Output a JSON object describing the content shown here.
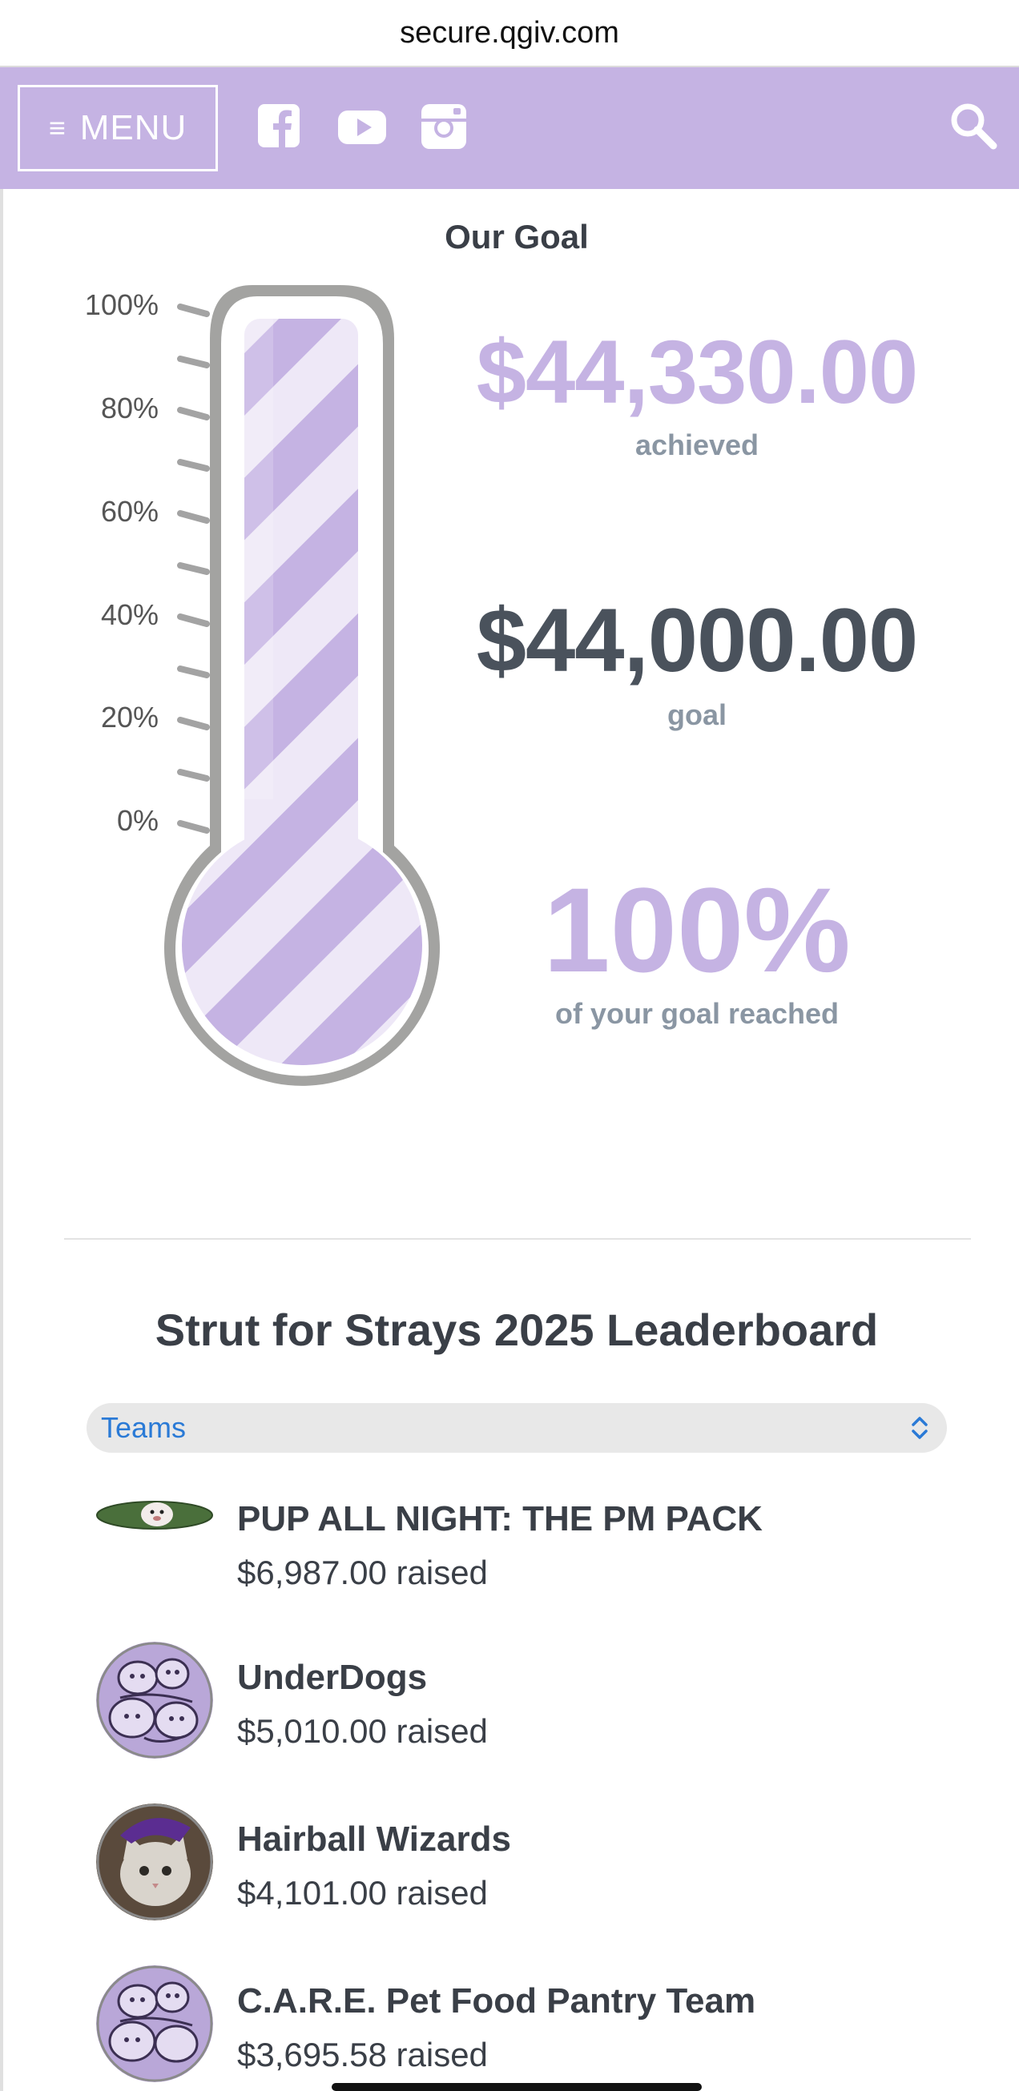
{
  "browser": {
    "url": "secure.qgiv.com"
  },
  "nav": {
    "menu_label": "MENU",
    "icons": [
      "facebook-icon",
      "youtube-icon",
      "instagram-icon",
      "search-icon"
    ],
    "bg_color": "#c5b3e3"
  },
  "goal": {
    "title": "Our Goal",
    "scale_labels": [
      "100%",
      "80%",
      "60%",
      "40%",
      "20%",
      "0%"
    ],
    "achieved_amount": "$44,330.00",
    "achieved_label": "achieved",
    "goal_amount": "$44,000.00",
    "goal_label": "goal",
    "percent": "100%",
    "percent_label": "of your goal reached",
    "fill_fraction": 1.0,
    "accent_color": "#c5b3e3"
  },
  "leaderboard": {
    "title": "Strut for Strays 2025 Leaderboard",
    "filter_value": "Teams",
    "items": [
      {
        "name": "PUP ALL NIGHT: THE PM PACK",
        "raised": "$6,987.00 raised",
        "avatar": "dog-photo"
      },
      {
        "name": "UnderDogs",
        "raised": "$5,010.00 raised",
        "avatar": "sketch-animals"
      },
      {
        "name": "Hairball Wizards",
        "raised": "$4,101.00 raised",
        "avatar": "cat-wizard-photo"
      },
      {
        "name": "C.A.R.E. Pet Food Pantry Team",
        "raised": "$3,695.58 raised",
        "avatar": "sketch-animals"
      }
    ]
  }
}
